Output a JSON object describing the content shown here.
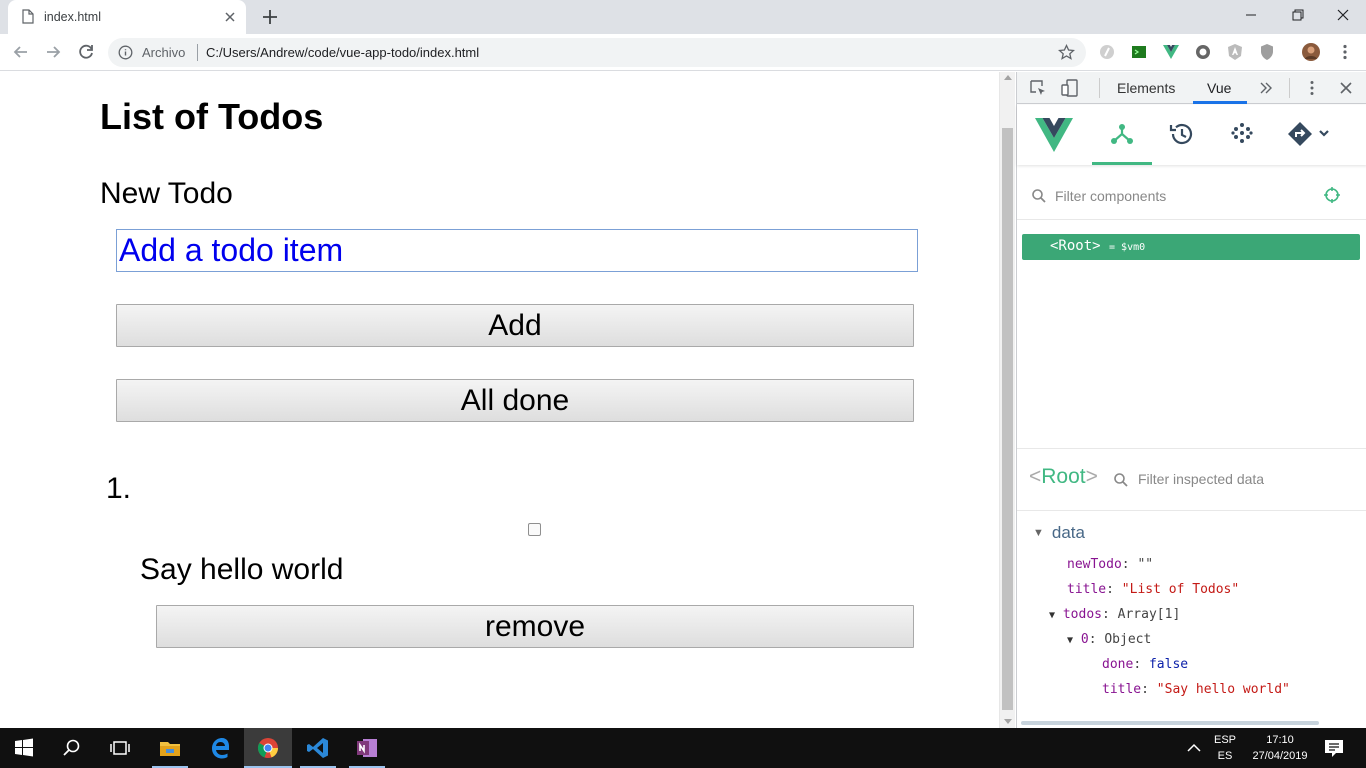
{
  "browser": {
    "tab_title": "index.html",
    "origin_label": "Archivo",
    "url": "C:/Users/Andrew/code/vue-app-todo/index.html"
  },
  "app": {
    "title": "List of Todos",
    "new_todo_heading": "New Todo",
    "input_value": "Add a todo item",
    "add_label": "Add",
    "all_done_label": "All done",
    "todos": [
      {
        "number": "1.",
        "done": false,
        "title": "Say hello world",
        "remove_label": "remove"
      }
    ]
  },
  "devtools": {
    "tabs": [
      "Elements",
      "Vue"
    ],
    "active_tab": "Vue",
    "filter_components_placeholder": "Filter components",
    "root_component": "<Root>",
    "root_vm": "= $vm0",
    "inspector": {
      "root_name": "Root",
      "filter_placeholder": "Filter inspected data",
      "section": "data",
      "rows": {
        "newTodo_key": "newTodo",
        "newTodo_val": "\"\"",
        "title_key": "title",
        "title_val": "\"List of Todos\"",
        "todos_key": "todos",
        "todos_val": "Array[1]",
        "item_key": "0",
        "item_val": "Object",
        "done_key": "done",
        "done_val": "false",
        "item_title_key": "title",
        "item_title_val": "\"Say hello world\""
      }
    }
  },
  "taskbar": {
    "lang_top": "ESP",
    "lang_bottom": "ES",
    "time": "17:10",
    "date": "27/04/2019"
  },
  "colors": {
    "vue_green": "#41b883",
    "root_row_bg": "#3ba776",
    "chrome_blue": "#1a73e8",
    "input_text": "#0000ee"
  }
}
